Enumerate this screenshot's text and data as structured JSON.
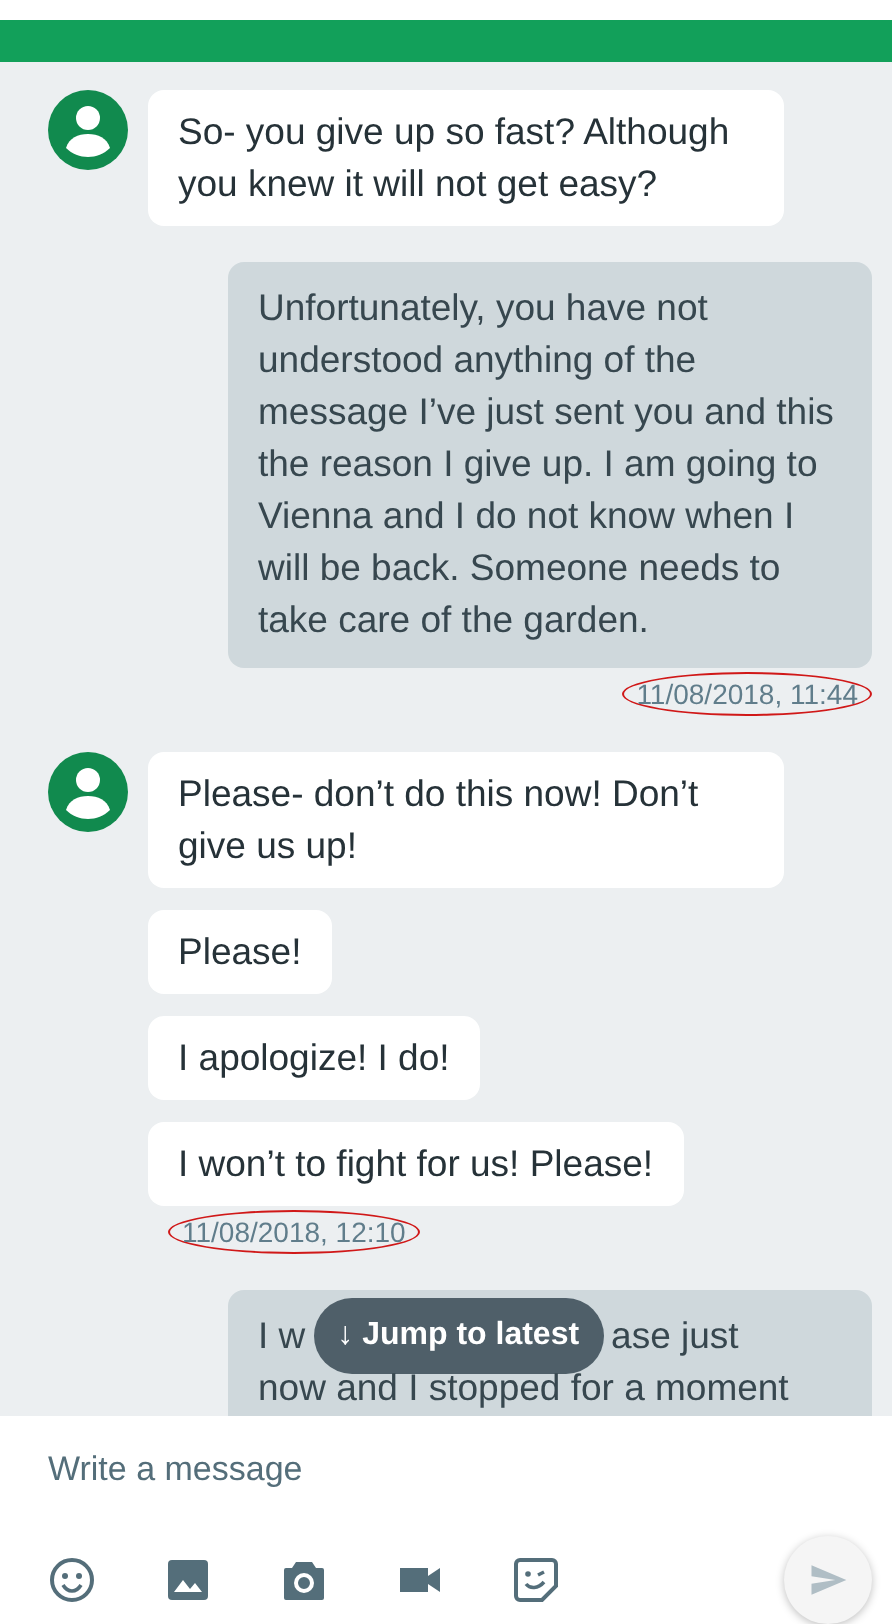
{
  "messages": [
    {
      "kind": "incoming",
      "avatar": true,
      "text": "So- you give up so fast? Although you knew it will not get easy?"
    },
    {
      "kind": "outgoing",
      "text": "Unfortunately, you have not understood anything of the message I’ve just sent you and this the reason I give up. I am going to Vienna and I do not know when I will be back. Someone needs to take care of the garden.",
      "timestamp": "11/08/2018, 11:44",
      "circled": true
    },
    {
      "kind": "incoming",
      "avatar": true,
      "text": "Please- don’t do this now! Don’t give us up!"
    },
    {
      "kind": "incoming",
      "avatar": false,
      "text": "Please!"
    },
    {
      "kind": "incoming",
      "avatar": false,
      "text": "I apologize! I do!"
    },
    {
      "kind": "incoming",
      "avatar": false,
      "text": "I won’t to fight for us! Please!",
      "timestamp": "11/08/2018, 12:10",
      "circled": true
    },
    {
      "kind": "outgoing_covered",
      "lead": "I w",
      "tail": "ase just",
      "text": "now and I stopped for a moment"
    }
  ],
  "jump_button": {
    "label": "↓ Jump to latest"
  },
  "composer": {
    "placeholder": "Write a message"
  }
}
